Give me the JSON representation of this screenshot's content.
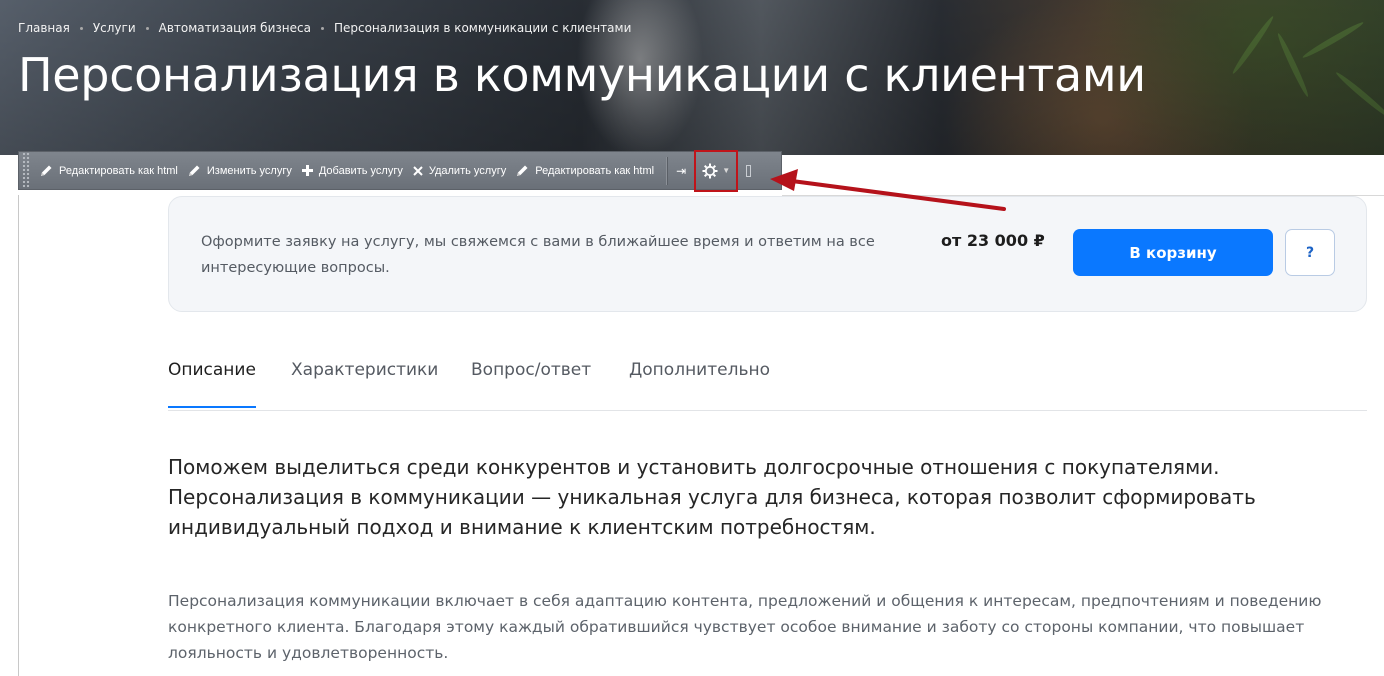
{
  "breadcrumbs": [
    "Главная",
    "Услуги",
    "Автоматизация бизнеса",
    "Персонализация в коммуникации с клиентами"
  ],
  "page_title": "Персонализация в коммуникации с клиентами",
  "toolbar": {
    "buttons": [
      {
        "label": "Редактировать как html",
        "icon": "pencil-icon"
      },
      {
        "label": "Изменить услугу",
        "icon": "pencil-icon"
      },
      {
        "label": "Добавить услугу",
        "icon": "plus-icon"
      },
      {
        "label": "Удалить услугу",
        "icon": "close-icon"
      },
      {
        "label": "Редактировать как html",
        "icon": "pencil-icon"
      }
    ],
    "pin_icon": "pin-icon",
    "settings_icon": "gear-icon",
    "highlight_color": "#c0141a"
  },
  "order_card": {
    "text": "Оформите заявку на услугу, мы свяжемся с вами в ближайшее время и ответим на все интересующие вопросы.",
    "price": "от 23 000 ₽",
    "cart_button": "В корзину",
    "help_button": "?"
  },
  "tabs": [
    {
      "label": "Описание",
      "active": true
    },
    {
      "label": "Характеристики",
      "active": false
    },
    {
      "label": "Вопрос/ответ",
      "active": false
    },
    {
      "label": "Дополнительно",
      "active": false
    }
  ],
  "content": {
    "lead": "Поможем выделиться среди конкурентов и установить долгосрочные отношения с покупателями. Персонализация в коммуникации — уникальная услуга для бизнеса, которая позволит сформировать индивидуальный подход и внимание к клиентским потребностям.",
    "paragraph": "Персонализация коммуникации включает в себя адаптацию контента, предложений и общения к интересам, предпочтениям и поведению конкретного клиента. Благодаря этому каждый обратившийся чувствует особое внимание и заботу со стороны компании, что повышает лояльность и удовлетворенность."
  },
  "colors": {
    "accent": "#0a78ff",
    "annotation_arrow": "#b5121b"
  }
}
